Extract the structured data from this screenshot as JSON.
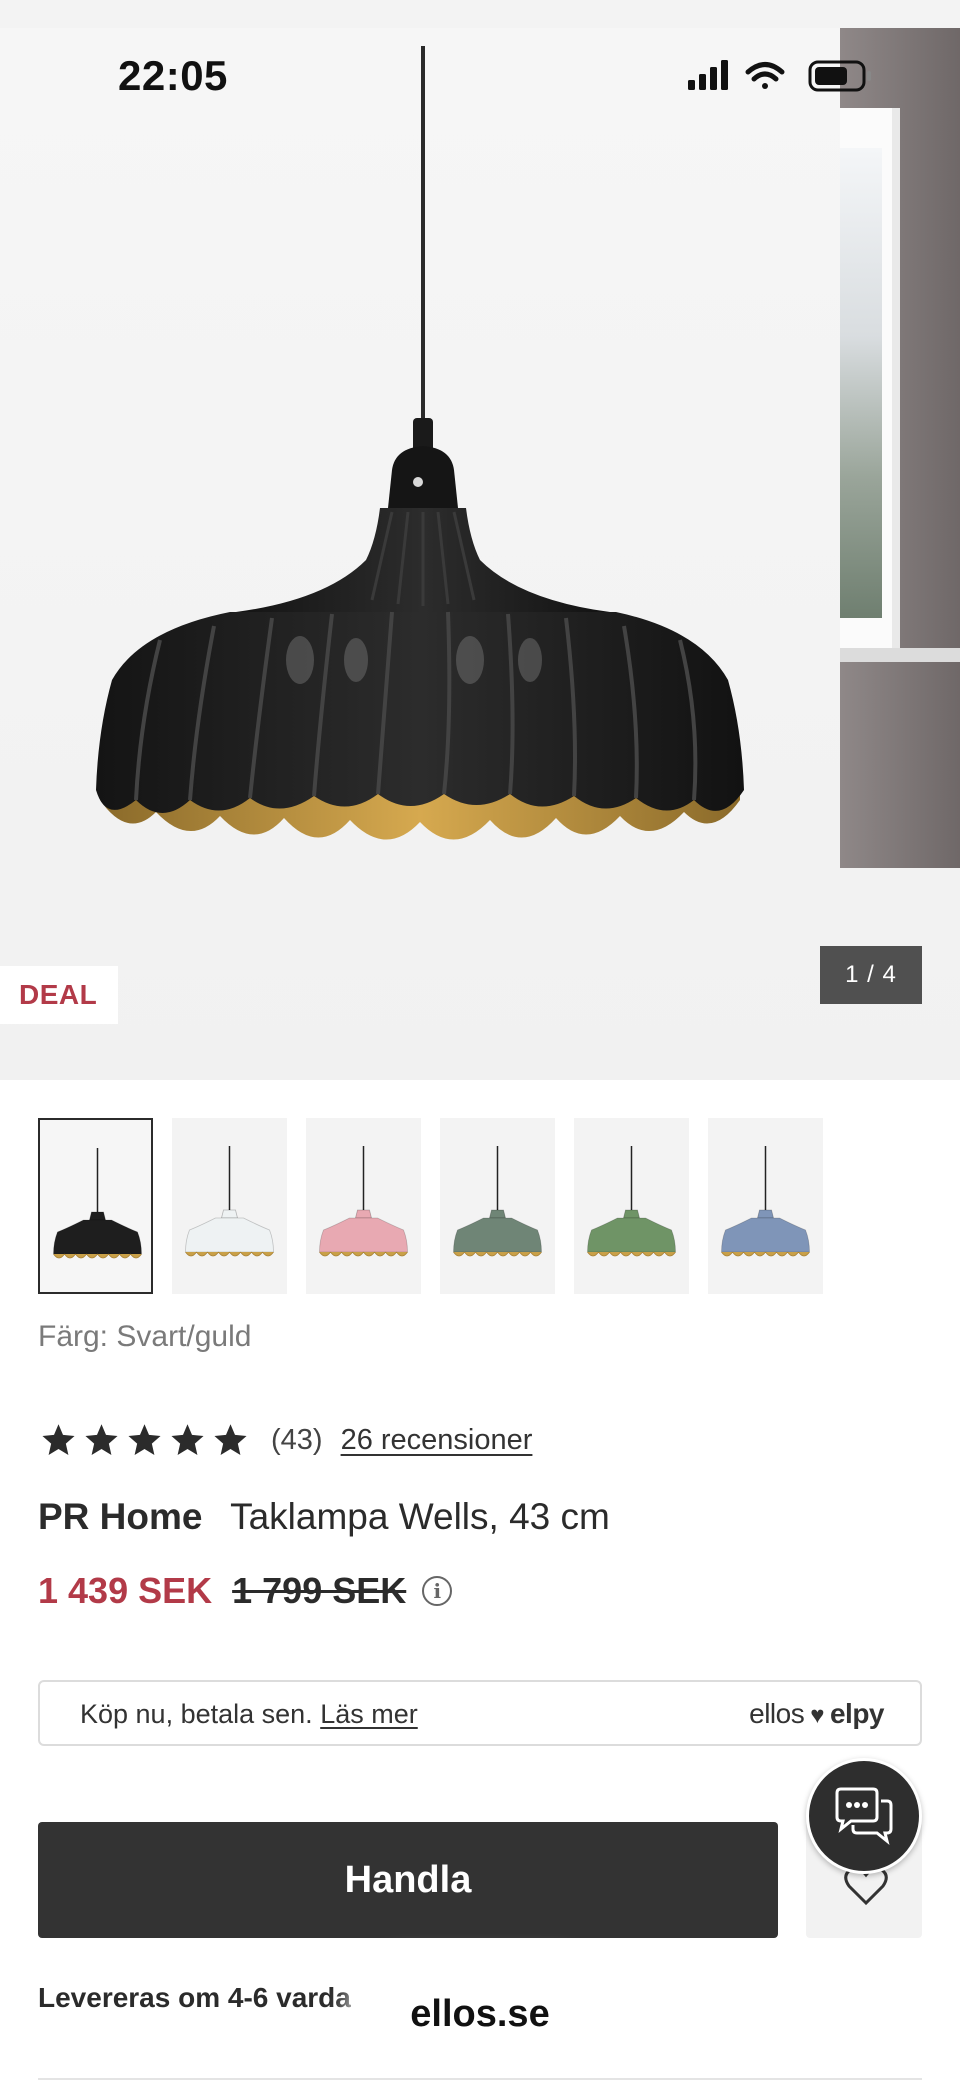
{
  "status_bar": {
    "time": "22:05"
  },
  "gallery": {
    "badge": "DEAL",
    "pager": "1 / 4",
    "current_color": "#1e1e1e"
  },
  "thumbnails": [
    {
      "color": "Svart/guld",
      "shade_hex": "#1e1e1e",
      "selected": true
    },
    {
      "shade_hex": "#eef2f3",
      "selected": false
    },
    {
      "shade_hex": "#e8a9b2",
      "selected": false
    },
    {
      "shade_hex": "#6f8576",
      "selected": false
    },
    {
      "shade_hex": "#6f9466",
      "selected": false
    },
    {
      "shade_hex": "#7f95b8",
      "selected": false
    }
  ],
  "color_selector": {
    "label": "Färg:",
    "value": "Svart/guld"
  },
  "rating": {
    "stars": 5,
    "count": "(43)",
    "reviews_link": "26 recensioner"
  },
  "product": {
    "brand": "PR Home",
    "name": "Taklampa Wells, 43 cm",
    "price": "1 439 SEK",
    "old_price": "1 799 SEK",
    "info_icon": "i"
  },
  "pay_later": {
    "text": "Köp nu, betala sen.",
    "link": "Läs mer",
    "logo_ellos": "ellos",
    "logo_elpy": "elpy"
  },
  "actions": {
    "buy_label": "Handla",
    "wishlist_icon": "heart-outline-icon",
    "chat_icon": "chat-bubbles-icon"
  },
  "delivery": {
    "text": "Levereras om 4-6 varda"
  },
  "browser": {
    "domain": "ellos.se"
  },
  "colors": {
    "accent_red": "#b23a48",
    "button_dark": "#333333",
    "pager_bg": "#505050"
  }
}
